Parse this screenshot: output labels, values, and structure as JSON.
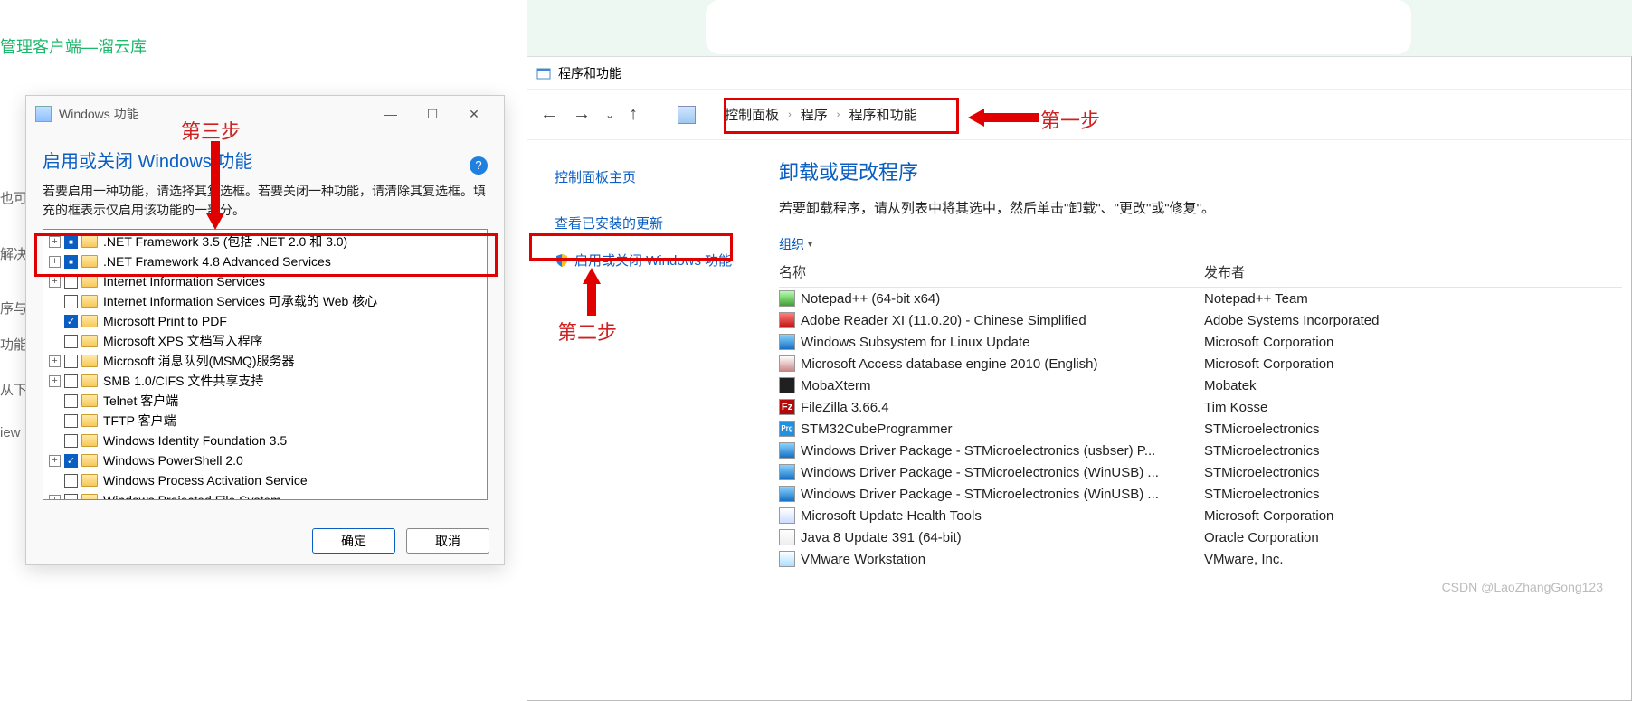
{
  "bg": {
    "title": "管理客户端—溜云库",
    "cut1": "也可",
    "cut2": "解决",
    "cut3": "序与",
    "cut4": "功能",
    "cut5": "从下",
    "cut6": "iew"
  },
  "annotations": {
    "step1": "第一步",
    "step2": "第二步",
    "step3": "第三步"
  },
  "featuresDialog": {
    "title": "Windows 功能",
    "heading": "启用或关闭 Windows 功能",
    "help": "?",
    "desc": "若要启用一种功能，请选择其复选框。若要关闭一种功能，请清除其复选框。填充的框表示仅启用该功能的一部分。",
    "ok": "确定",
    "cancel": "取消",
    "items": [
      {
        "exp": true,
        "state": "filled",
        "label": ".NET Framework 3.5 (包括 .NET 2.0 和 3.0)"
      },
      {
        "exp": true,
        "state": "filled",
        "label": ".NET Framework 4.8 Advanced Services"
      },
      {
        "exp": true,
        "state": "",
        "label": "Internet Information Services"
      },
      {
        "exp": false,
        "state": "",
        "label": "Internet Information Services 可承载的 Web 核心"
      },
      {
        "exp": false,
        "state": "checked",
        "label": "Microsoft Print to PDF"
      },
      {
        "exp": false,
        "state": "",
        "label": "Microsoft XPS 文档写入程序"
      },
      {
        "exp": true,
        "state": "",
        "label": "Microsoft 消息队列(MSMQ)服务器"
      },
      {
        "exp": true,
        "state": "",
        "label": "SMB 1.0/CIFS 文件共享支持"
      },
      {
        "exp": false,
        "state": "",
        "label": "Telnet 客户端"
      },
      {
        "exp": false,
        "state": "",
        "label": "TFTP 客户端"
      },
      {
        "exp": false,
        "state": "",
        "label": "Windows Identity Foundation 3.5"
      },
      {
        "exp": true,
        "state": "checked",
        "label": "Windows PowerShell 2.0"
      },
      {
        "exp": false,
        "state": "",
        "label": "Windows Process Activation Service"
      },
      {
        "exp": true,
        "state": "",
        "label": "Windows Projected File System"
      }
    ]
  },
  "cp": {
    "windowTitle": "程序和功能",
    "crumbs": [
      "控制面板",
      "程序",
      "程序和功能"
    ],
    "side": {
      "home": "控制面板主页",
      "updates": "查看已安装的更新",
      "toggle": "启用或关闭 Windows 功能"
    },
    "mainHeading": "卸载或更改程序",
    "mainSub": "若要卸载程序，请从列表中将其选中，然后单击\"卸载\"、\"更改\"或\"修复\"。",
    "organize": "组织",
    "cols": {
      "name": "名称",
      "publisher": "发布者"
    },
    "programs": [
      {
        "icon": "green",
        "name": "Notepad++ (64-bit x64)",
        "pub": "Notepad++ Team"
      },
      {
        "icon": "red",
        "name": "Adobe Reader XI (11.0.20) - Chinese Simplified",
        "pub": "Adobe Systems Incorporated"
      },
      {
        "icon": "win",
        "name": "Windows Subsystem for Linux Update",
        "pub": "Microsoft Corporation"
      },
      {
        "icon": "db",
        "name": "Microsoft Access database engine 2010 (English)",
        "pub": "Microsoft Corporation"
      },
      {
        "icon": "dark",
        "name": "MobaXterm",
        "pub": "Mobatek"
      },
      {
        "icon": "fz",
        "name": "FileZilla 3.66.4",
        "pub": "Tim Kosse"
      },
      {
        "icon": "prg",
        "name": "STM32CubeProgrammer",
        "pub": "STMicroelectronics"
      },
      {
        "icon": "win",
        "name": "Windows Driver Package - STMicroelectronics (usbser) P...",
        "pub": "STMicroelectronics"
      },
      {
        "icon": "win",
        "name": "Windows Driver Package - STMicroelectronics (WinUSB) ...",
        "pub": "STMicroelectronics"
      },
      {
        "icon": "win",
        "name": "Windows Driver Package - STMicroelectronics (WinUSB) ...",
        "pub": "STMicroelectronics"
      },
      {
        "icon": "health",
        "name": "Microsoft Update Health Tools",
        "pub": "Microsoft Corporation"
      },
      {
        "icon": "java",
        "name": "Java 8 Update 391 (64-bit)",
        "pub": "Oracle Corporation"
      },
      {
        "icon": "vm",
        "name": "VMware Workstation",
        "pub": "VMware, Inc."
      }
    ]
  },
  "watermark": "CSDN @LaoZhangGong123"
}
